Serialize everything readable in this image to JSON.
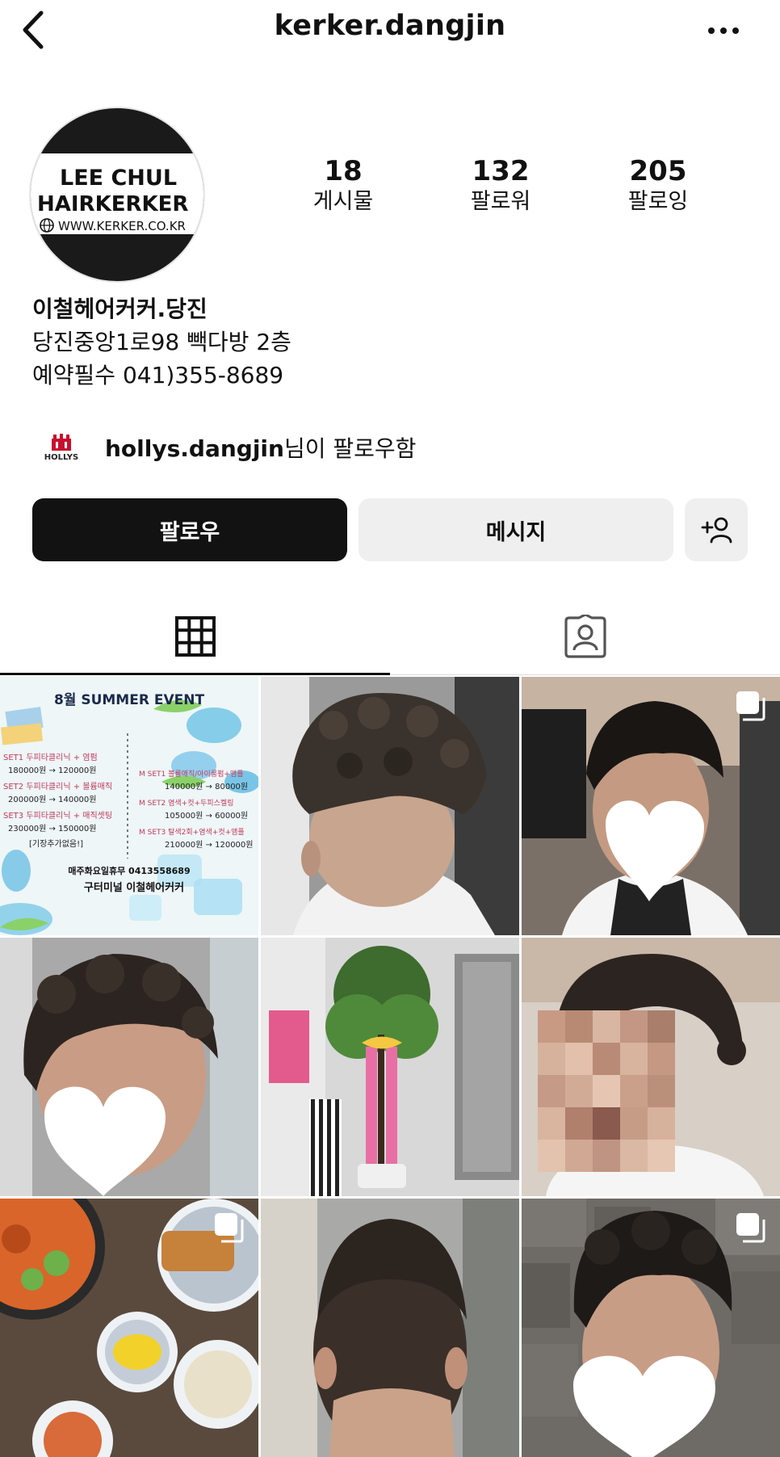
{
  "header": {
    "username": "kerker.dangjin"
  },
  "avatar": {
    "line1": "LEE CHUL",
    "line2": "HAIRKERKER",
    "url": "WWW.KERKER.CO.KR"
  },
  "stats": [
    {
      "value": "18",
      "label": "게시물"
    },
    {
      "value": "132",
      "label": "팔로워"
    },
    {
      "value": "205",
      "label": "팔로잉"
    }
  ],
  "bio": {
    "name": "이철헤어커커.당진",
    "line1": "당진중앙1로98 빽다방 2층",
    "line2": "예약필수 041)355-8689"
  },
  "followed_by": {
    "username": "hollys.dangjin",
    "suffix": "님이 팔로우함",
    "logo_text": "HOLLYS"
  },
  "buttons": {
    "follow": "팔로우",
    "message": "메시지"
  },
  "posts": {
    "event": {
      "title": "8월 SUMMER EVENT",
      "left": [
        {
          "set": "SET1 두피타클리닉 + 염펌",
          "price": "180000원 → 120000원"
        },
        {
          "set": "SET2 두피타클리닉 + 볼륨매직",
          "price": "200000원 → 140000원"
        },
        {
          "set": "SET3 두피타클리닉 + 매직셋팅",
          "price": "230000원 → 150000원"
        }
      ],
      "left_note": "[기장추가없음!]",
      "right": [
        {
          "set": "M SET1 볼륨매직/아이롱펌+앰플",
          "price": "140000원 → 80000원"
        },
        {
          "set": "M SET2 염색+컷+두피스켈링",
          "price": "105000원 → 60000원"
        },
        {
          "set": "M SET3 탈색2회+염색+컷+앰플",
          "price": "210000원 → 120000원"
        }
      ],
      "footer1": "매주화요일휴무 0413558689",
      "footer2": "구터미널 이철헤어커커"
    }
  },
  "colors": {
    "follow_bg": "#121212",
    "button_bg": "#efefef",
    "divider": "#dbdbdb"
  }
}
